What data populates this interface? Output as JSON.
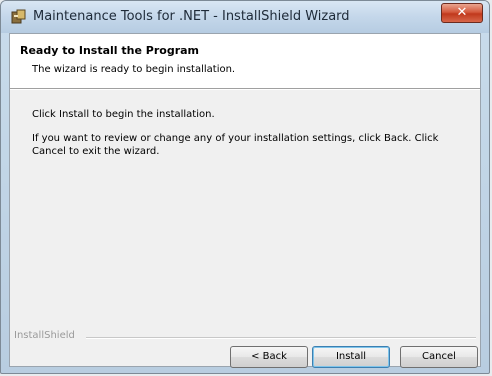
{
  "window": {
    "title": "Maintenance Tools for .NET - InstallShield Wizard",
    "close_label": "✕"
  },
  "banner": {
    "title": "Ready to Install the Program",
    "subtitle": "The wizard is ready to begin installation."
  },
  "body": {
    "paragraph1": "Click Install to begin the installation.",
    "paragraph2": "If you want to review or change any of your installation settings, click Back. Click Cancel to exit the wizard."
  },
  "footer": {
    "brand": "InstallShield"
  },
  "buttons": {
    "back": "< Back",
    "install": "Install",
    "cancel": "Cancel"
  },
  "colors": {
    "title_bar": "#c4d7ea",
    "close_button": "#c0391c",
    "client_background": "#f0f0f0"
  }
}
